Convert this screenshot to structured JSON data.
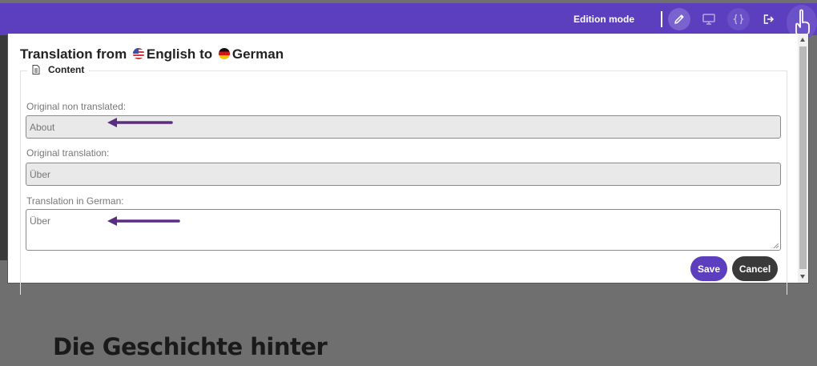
{
  "background": {
    "heading": "Die Geschichte hinter"
  },
  "toolbar": {
    "mode_label": "Edition mode",
    "buttons": [
      {
        "icon": "pencil-icon",
        "active": true
      },
      {
        "icon": "monitor-icon",
        "active": false
      },
      {
        "icon": "code-braces-icon",
        "active": false
      },
      {
        "icon": "logout-icon",
        "active": false
      }
    ],
    "accent": "#5b3fbf"
  },
  "modal": {
    "title_prefix": "Translation from",
    "source_language": "English",
    "connector": "to",
    "target_language": "German",
    "section_label": "Content",
    "section_icon": "document-icon",
    "fields": {
      "original_label": "Original non translated:",
      "original_value": "About",
      "original_translation_label": "Original translation:",
      "original_translation_value": "Über",
      "translation_label": "Translation in German:",
      "translation_value": "Über"
    },
    "save_label": "Save",
    "cancel_label": "Cancel"
  },
  "colors": {
    "annotation_arrow": "#5b2d82",
    "cancel_button": "#3a3a3a"
  }
}
